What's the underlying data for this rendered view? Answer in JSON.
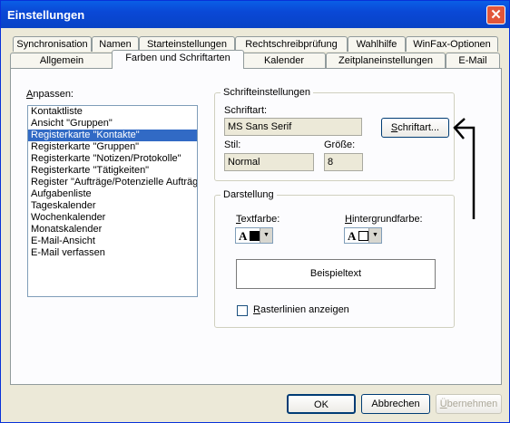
{
  "window": {
    "title": "Einstellungen",
    "close_label": "✕"
  },
  "tabs_row1": [
    "Synchronisation",
    "Namen",
    "Starteinstellungen",
    "Rechtschreibprüfung",
    "Wahlhilfe",
    "WinFax-Optionen"
  ],
  "tabs_row2": [
    "Allgemein",
    "Farben und Schriftarten",
    "Kalender",
    "Zeitplaneinstellungen",
    "E-Mail"
  ],
  "customize": {
    "label_access": "A",
    "label_rest": "npassen:",
    "items": [
      "Kontaktliste",
      "Ansicht \"Gruppen\"",
      "Registerkarte \"Kontakte\"",
      "Registerkarte \"Gruppen\"",
      "Registerkarte \"Notizen/Protokolle\"",
      "Registerkarte \"Tätigkeiten\"",
      "Register \"Aufträge/Potenzielle Aufträge\"",
      "Aufgabenliste",
      "Tageskalender",
      "Wochenkalender",
      "Monatskalender",
      "E-Mail-Ansicht",
      "E-Mail verfassen"
    ],
    "selected_index": 2
  },
  "font_settings": {
    "title": "Schrifteinstellungen",
    "font_label": "Schriftart:",
    "font_value": "MS Sans Serif",
    "font_button_access": "S",
    "font_button_rest": "chriftart...",
    "style_label": "Stil:",
    "style_value": "Normal",
    "size_label": "Größe:",
    "size_value": "8"
  },
  "display": {
    "title": "Darstellung",
    "text_color_access": "T",
    "text_color_rest": "extfarbe:",
    "text_color": "#000000",
    "bg_color_access": "H",
    "bg_color_rest": "intergrundfarbe:",
    "bg_color": "#ffffff",
    "sample_letter": "A",
    "dropdown_arrow": "▼",
    "sample_text": "Beispieltext",
    "gridlines_access": "R",
    "gridlines_rest": "asterlinien anzeigen",
    "gridlines_checked": false
  },
  "buttons": {
    "ok": "OK",
    "cancel": "Abbrechen",
    "apply_access": "Ü",
    "apply_rest": "bernehmen"
  }
}
